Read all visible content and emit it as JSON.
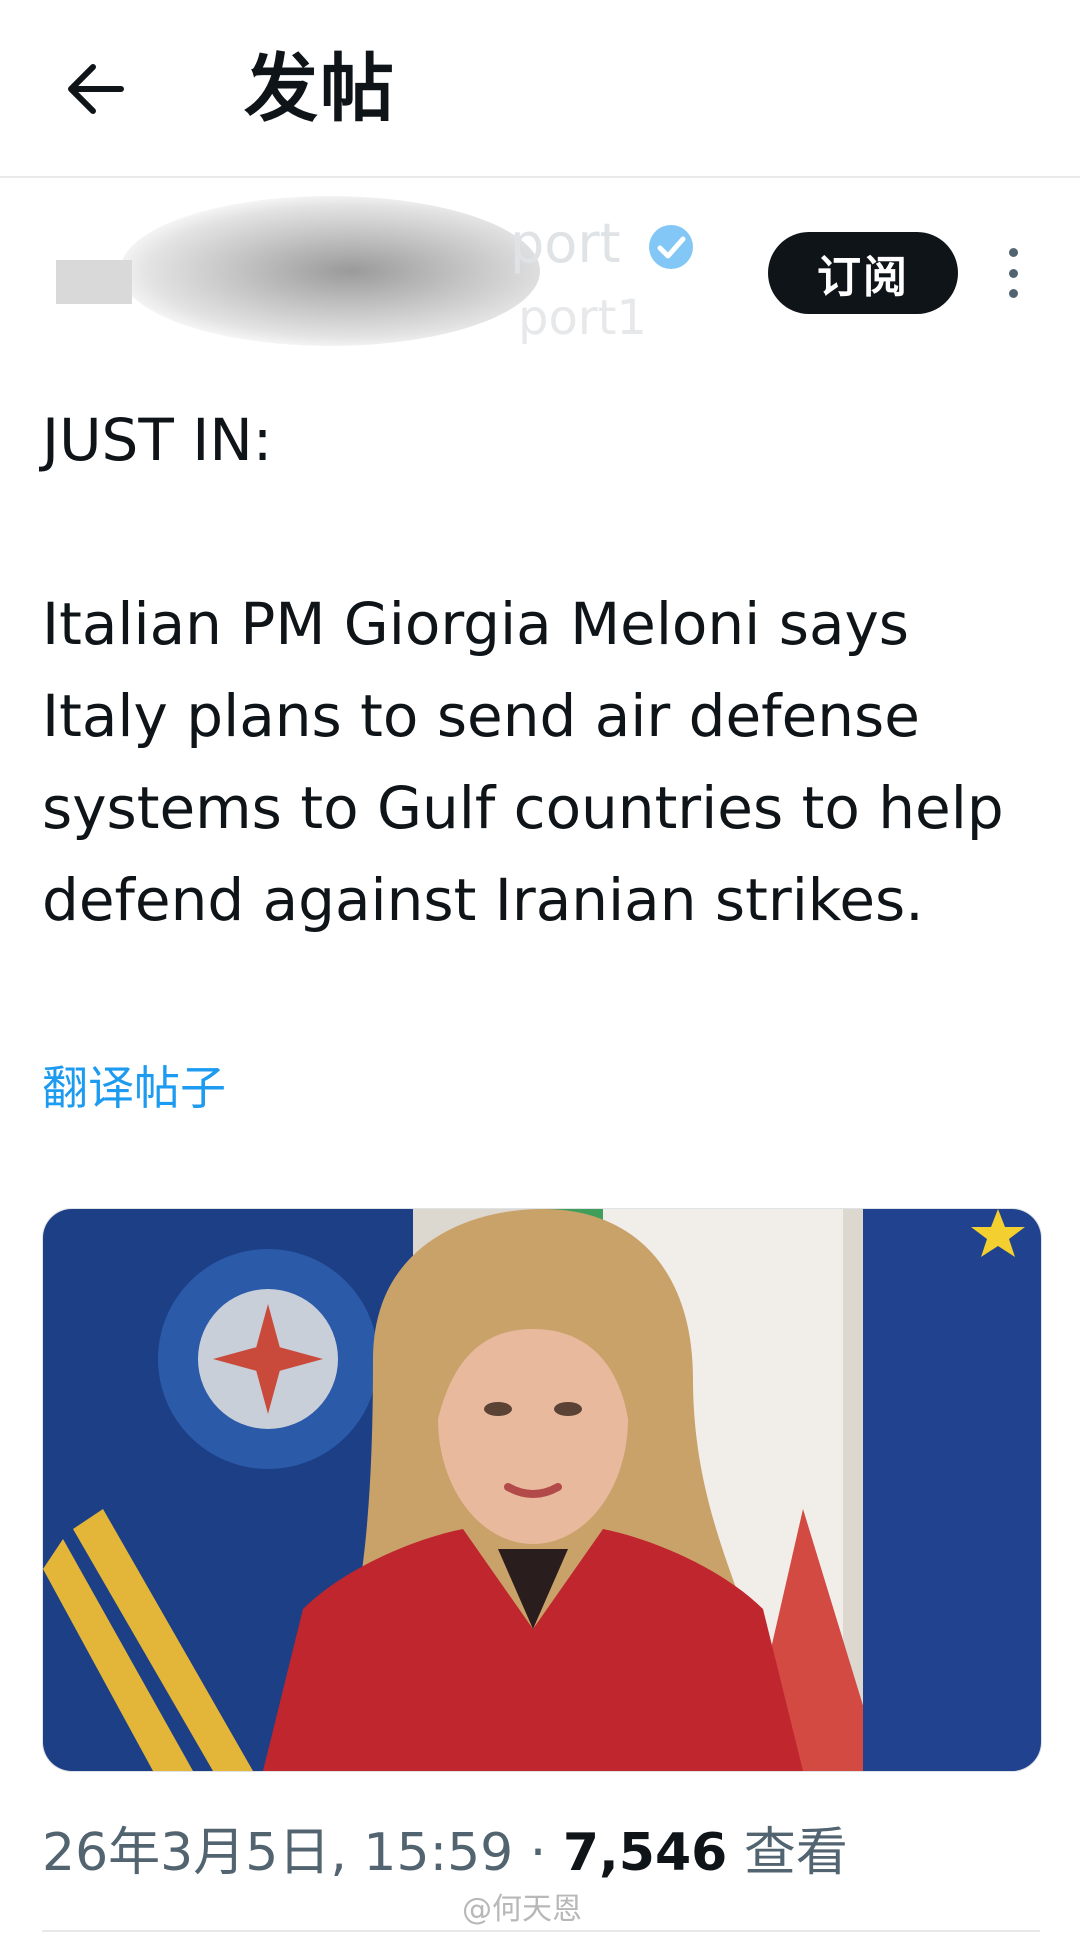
{
  "header": {
    "title": "发帖",
    "back_icon": "arrow-left-icon"
  },
  "author": {
    "name": "port",
    "handle": "port1",
    "subscribe_label": "订阅",
    "verified_icon": "verified-badge-icon",
    "more_icon": "more-vertical-icon"
  },
  "tweet": {
    "lead": "JUST IN:",
    "body": "Italian PM Giorgia Meloni says Italy plans to send air defense systems to Gulf countries to help defend against Iranian strikes.",
    "translate_label": "翻译帖子"
  },
  "media": {
    "type": "photo"
  },
  "meta": {
    "timestamp": "26年3月5日, 15:59",
    "separator": " · ",
    "views_count": "7,546",
    "views_label": " 查看"
  },
  "watermark": "@何天恩",
  "colors": {
    "accent": "#1d9bf0",
    "text": "#0f1419",
    "secondary": "#536471",
    "button_bg": "#0f1419"
  }
}
